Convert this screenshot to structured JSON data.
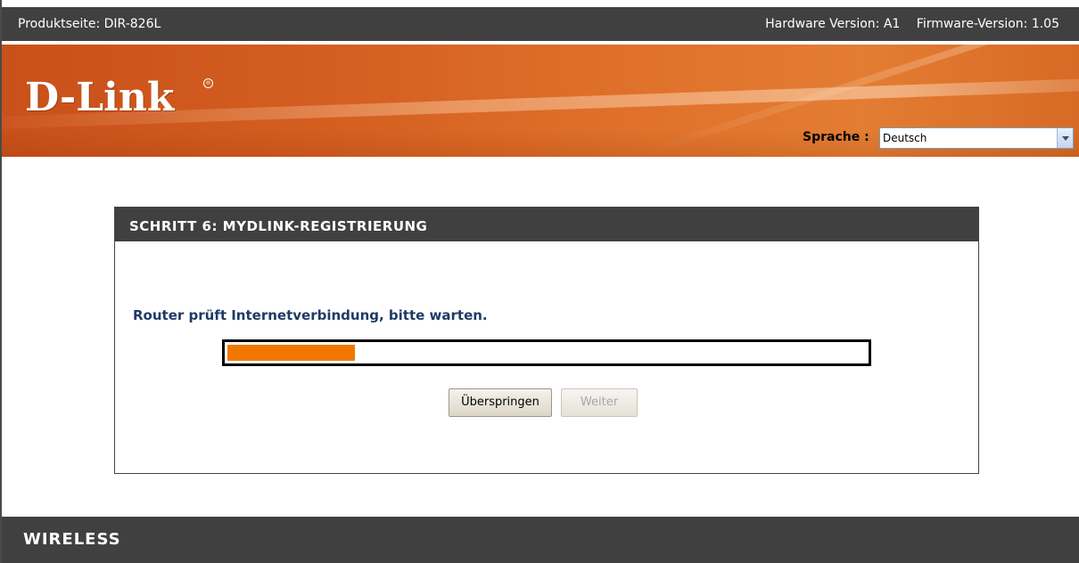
{
  "topbar": {
    "product_page": "Produktseite: DIR-826L",
    "hardware_version": "Hardware Version: A1",
    "firmware_version": "Firmware-Version: 1.05"
  },
  "header": {
    "logo_text": "D-Link",
    "logo_mark": "®",
    "language_label": "Sprache :",
    "language_value": "Deutsch"
  },
  "step": {
    "title": "SCHRITT 6: MYDLINK-REGISTRIERUNG",
    "message": "Router prüft Internetverbindung, bitte warten.",
    "progress_fraction": 0.2,
    "skip_label": "Überspringen",
    "next_label": "Weiter"
  },
  "footer": {
    "label": "WIRELESS"
  },
  "colors": {
    "dark_bar": "#404040",
    "banner_orange": "#d45e20",
    "progress_fill": "#f07800",
    "message_blue": "#1f3a66"
  }
}
